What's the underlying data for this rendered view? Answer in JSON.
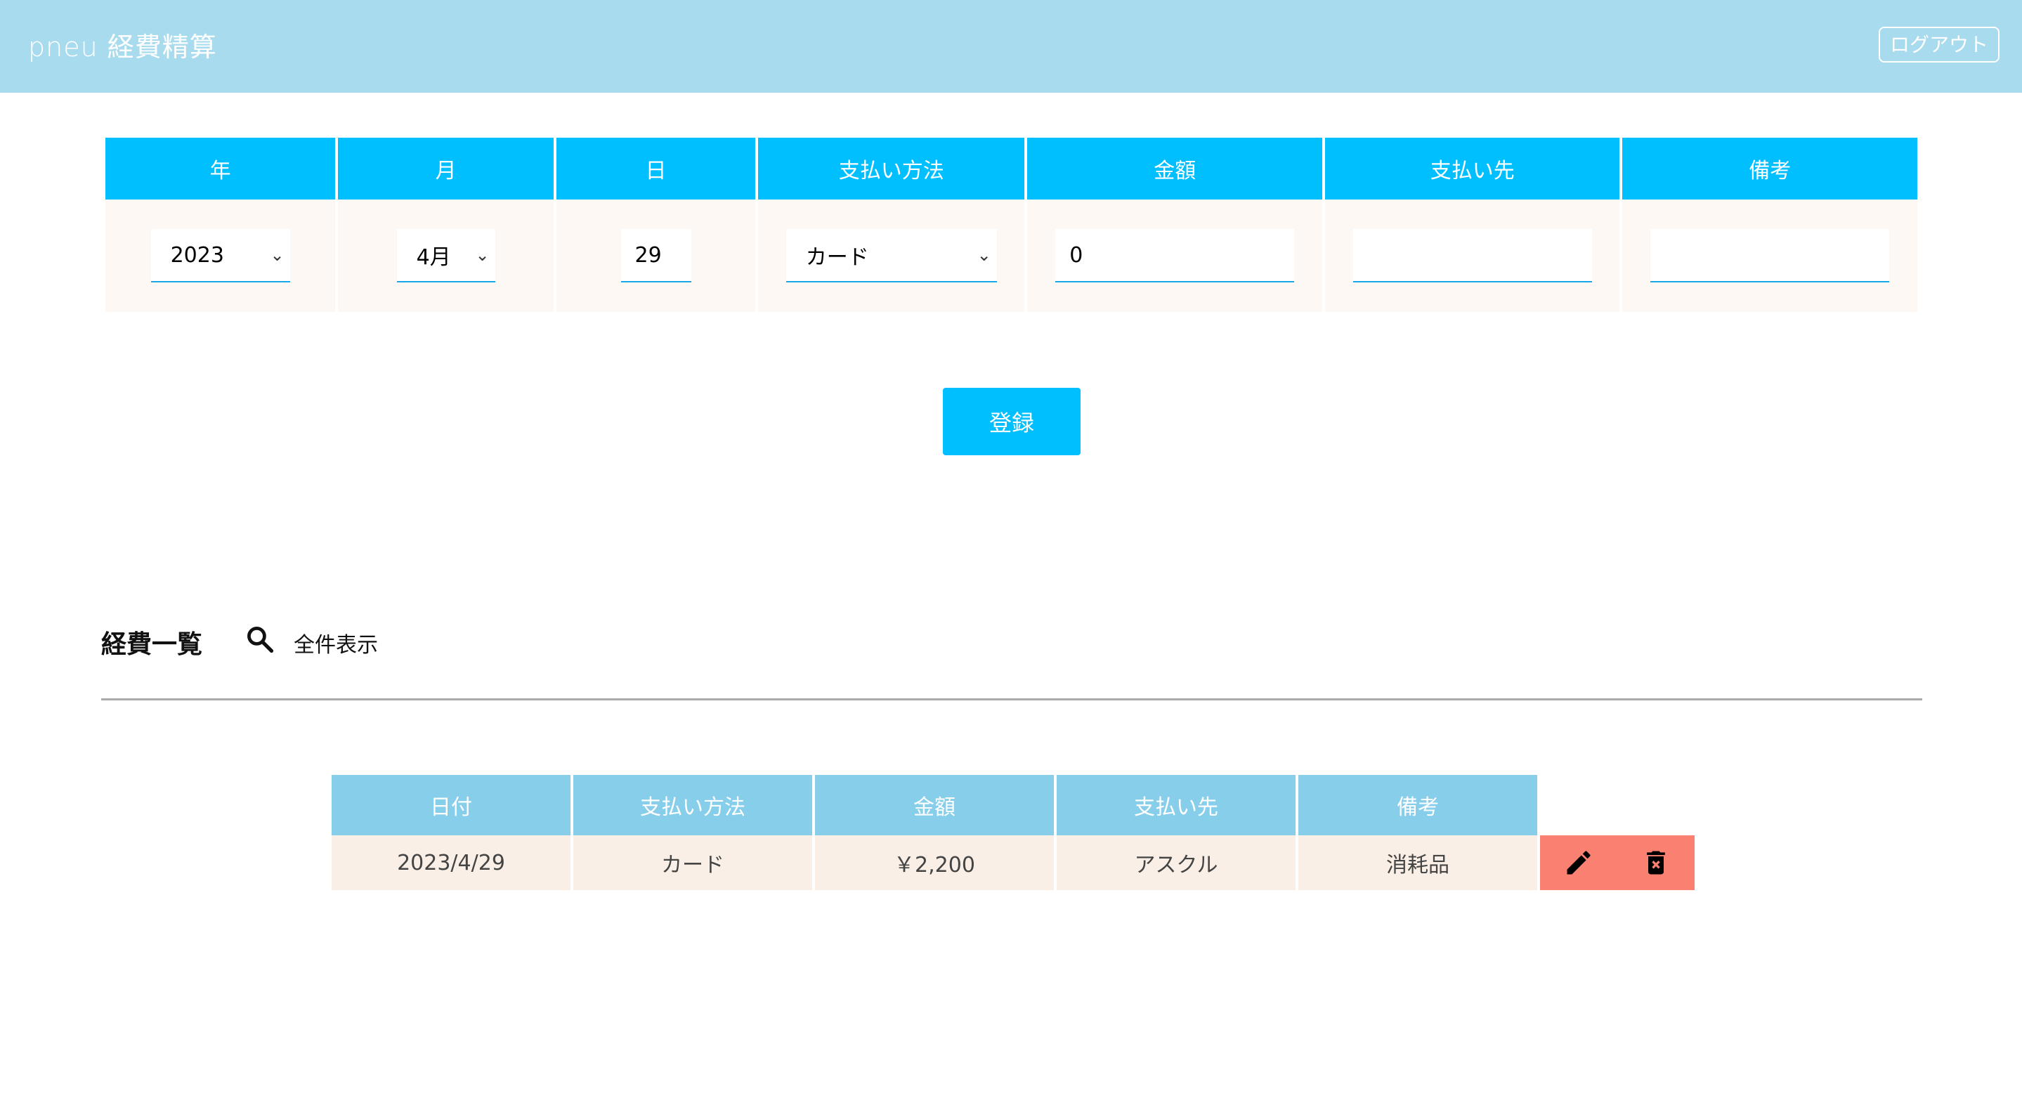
{
  "header": {
    "title": "pneu 経費精算",
    "logout_label": "ログアウト"
  },
  "entry_form": {
    "headers": [
      "年",
      "月",
      "日",
      "支払い方法",
      "金額",
      "支払い先",
      "備考"
    ],
    "year": "2023",
    "month": "4月",
    "day": "29",
    "payment_method": "カード",
    "amount": "0",
    "payee": "",
    "note": "",
    "register_label": "登録"
  },
  "list": {
    "title": "経費一覧",
    "show_all_label": "全件表示",
    "headers": [
      "日付",
      "支払い方法",
      "金額",
      "支払い先",
      "備考"
    ],
    "rows": [
      {
        "date": "2023/4/29",
        "method": "カード",
        "amount": "￥2,200",
        "payee": "アスクル",
        "note": "消耗品"
      }
    ]
  },
  "icons": {
    "search": "search-icon",
    "edit": "pencil-icon",
    "delete": "trash-icon",
    "dropdown": "chevron-down-icon"
  },
  "colors": {
    "header_bg": "#a8dbee",
    "primary": "#00bfff",
    "list_header": "#87ceeb",
    "action_bg": "#fa8072"
  }
}
